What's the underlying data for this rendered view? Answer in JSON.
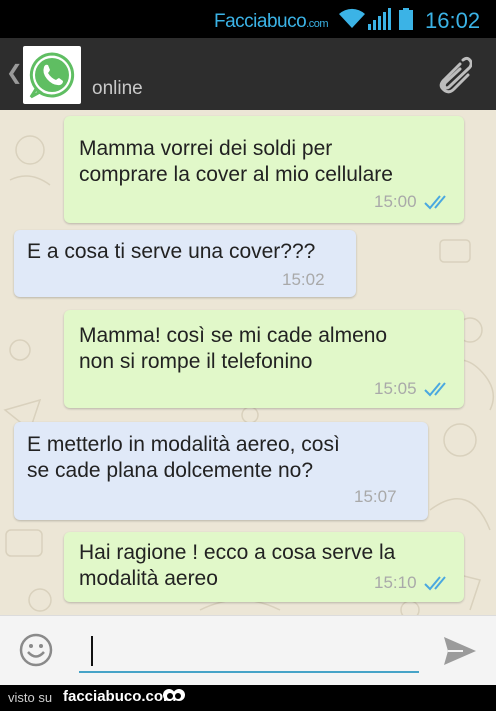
{
  "status_bar": {
    "brand": "Facciabuco",
    "brand_suffix": ".com",
    "time": "16:02",
    "icons": [
      "wifi-icon",
      "signal-icon",
      "battery-icon"
    ],
    "accent_color": "#3bb3e6"
  },
  "header": {
    "back_icon": "chevron-left-icon",
    "avatar_icon": "whatsapp-logo",
    "status": "online",
    "attach_icon": "paperclip-icon"
  },
  "messages": [
    {
      "direction": "outgoing",
      "lines": [
        "Mamma vorrei dei soldi per",
        "comprare la cover al mio cellulare"
      ],
      "time": "15:00",
      "read": true
    },
    {
      "direction": "incoming",
      "lines": [
        "E a cosa ti serve una cover???"
      ],
      "time": "15:02",
      "read": false
    },
    {
      "direction": "outgoing",
      "lines": [
        "Mamma! così se mi cade almeno",
        "non si rompe il telefonino"
      ],
      "time": "15:05",
      "read": true
    },
    {
      "direction": "incoming",
      "lines": [
        "E metterlo in modalità aereo, così",
        "se cade plana dolcemente no?"
      ],
      "time": "15:07",
      "read": false
    },
    {
      "direction": "outgoing",
      "lines": [
        "Hai ragione ! ecco a cosa serve la",
        "modalità aereo"
      ],
      "time": "15:10",
      "read": true
    }
  ],
  "colors": {
    "outgoing_bubble": "#e1f8c9",
    "incoming_bubble": "#e0e9f8",
    "chat_background": "#ece6d6",
    "read_ticks": "#4aa8e0"
  },
  "composer": {
    "emoji_icon": "smiley-icon",
    "input_value": "",
    "send_icon": "send-icon"
  },
  "footer": {
    "seen_on": "visto su",
    "site": "facciabuco.com",
    "mascot_icon": "eyes-icon"
  }
}
